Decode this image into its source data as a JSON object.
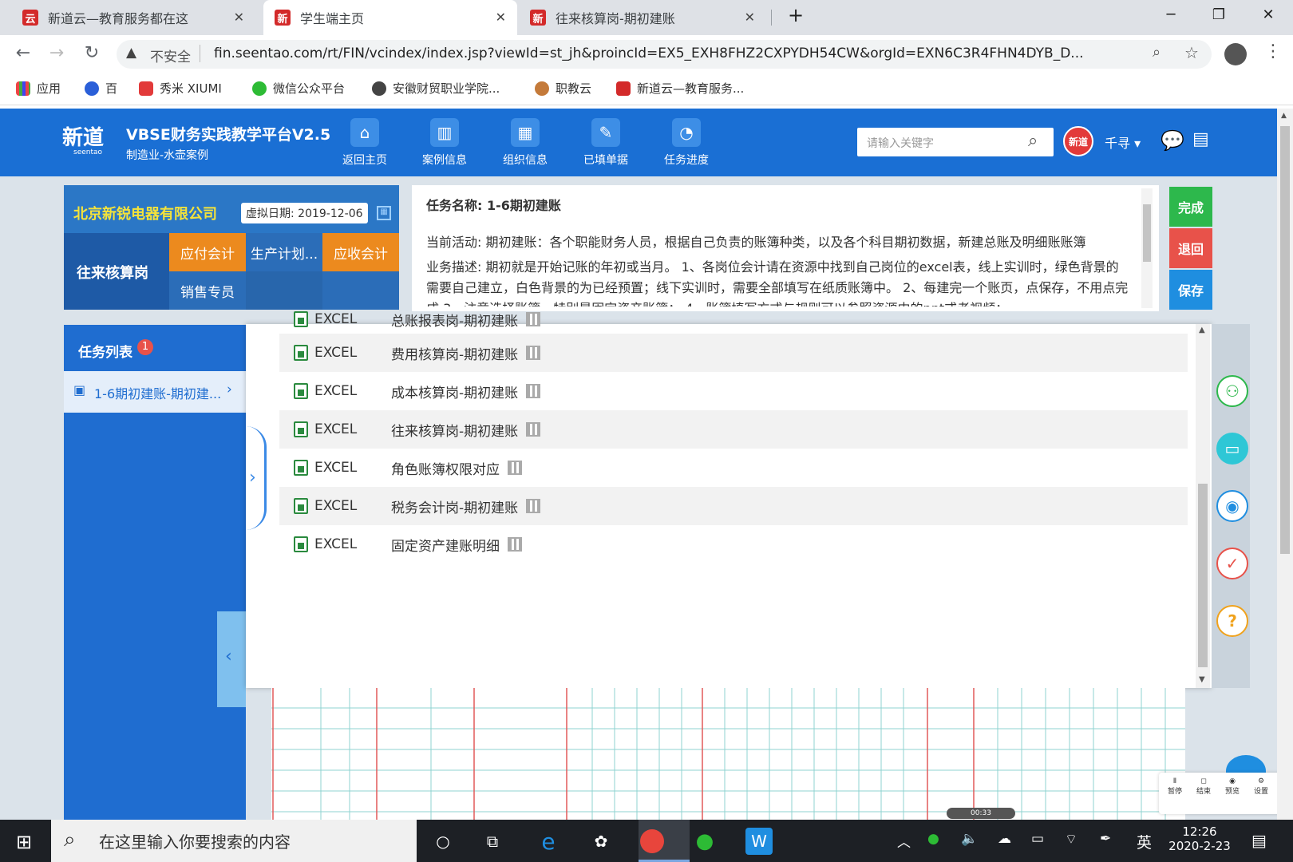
{
  "browser": {
    "tabs": [
      {
        "label": "新道云—教育服务都在这",
        "icon": "云"
      },
      {
        "label": "学生端主页",
        "icon": "新"
      },
      {
        "label": "往来核算岗-期初建账",
        "icon": "新"
      }
    ],
    "new_tab": "+",
    "security_label": "不安全",
    "url": "fin.seentao.com/rt/FIN/vcindex/index.jsp?viewId=st_jh&proincId=EX5_EXH8FHZ2CXPYDH54CW&orgId=EXN6C3R4FHN4DYB_D...",
    "bookmarks": [
      "应用",
      "百",
      "秀米 XIUMI",
      "微信公众平台",
      "安徽财贸职业学院...",
      "职教云",
      "新道云—教育服务..."
    ]
  },
  "header": {
    "logo_main": "新道",
    "logo_sub": "seentao",
    "title": "VBSE财务实践教学平台V2.5",
    "subtitle": "制造业-水壶案例",
    "nav": [
      "返回主页",
      "案例信息",
      "组织信息",
      "已填单据",
      "任务进度"
    ],
    "search_placeholder": "请输入关键字",
    "avatar_text": "新道",
    "user": "千寻"
  },
  "company": {
    "name": "北京新锐电器有限公司",
    "date_label": "虚拟日期:",
    "date": "2019-12-06",
    "role": "往来核算岗",
    "roles": [
      "应付会计",
      "生产计划...",
      "应收会计",
      "销售专员"
    ]
  },
  "task": {
    "name_label": "任务名称:",
    "name": "1-6期初建账",
    "activity_label": "当前活动:",
    "activity": "期初建账：各个职能财务人员，根据自己负责的账簿种类，以及各个科目期初数据，新建总账及明细账账簿",
    "desc_label": "业务描述:",
    "desc": "期初就是开始记账的年初或当月。 1、各岗位会计请在资源中找到自己岗位的excel表，线上实训时，绿色背景的需要自己建立，白色背景的为已经预置；线下实训时，需要全部填写在纸质账簿中。 2、每建完一个账页，点保存，不用点完成 3、注意选择账簿，特别是固定资产账簿； 4、账簿填写方式与规则可以参照资源中的ppt或者视频；"
  },
  "actions": {
    "complete": "完成",
    "back": "退回",
    "save": "保存"
  },
  "tasklist": {
    "title": "任务列表",
    "badge": "1",
    "item": "1-6期初建账-期初建..."
  },
  "resources": {
    "partial_row": {
      "type": "EXCEL",
      "name": "总账报表岗-期初建账"
    },
    "rows": [
      {
        "type": "EXCEL",
        "name": "费用核算岗-期初建账"
      },
      {
        "type": "EXCEL",
        "name": "成本核算岗-期初建账"
      },
      {
        "type": "EXCEL",
        "name": "往来核算岗-期初建账"
      },
      {
        "type": "EXCEL",
        "name": "角色账簿权限对应"
      },
      {
        "type": "EXCEL",
        "name": "税务会计岗-期初建账"
      },
      {
        "type": "EXCEL",
        "name": "固定资产建账明细"
      }
    ]
  },
  "recorder": {
    "labels": [
      "暂停",
      "结束",
      "预览",
      "设置"
    ],
    "time": "00:33"
  },
  "taskbar": {
    "search_placeholder": "在这里输入你要搜索的内容",
    "ime": "英",
    "time": "12:26",
    "date": "2020-2-23"
  },
  "colors": {
    "brand_blue": "#1a6fd4",
    "green": "#2db84c",
    "red": "#e8524a",
    "orange": "#f08a1c"
  }
}
